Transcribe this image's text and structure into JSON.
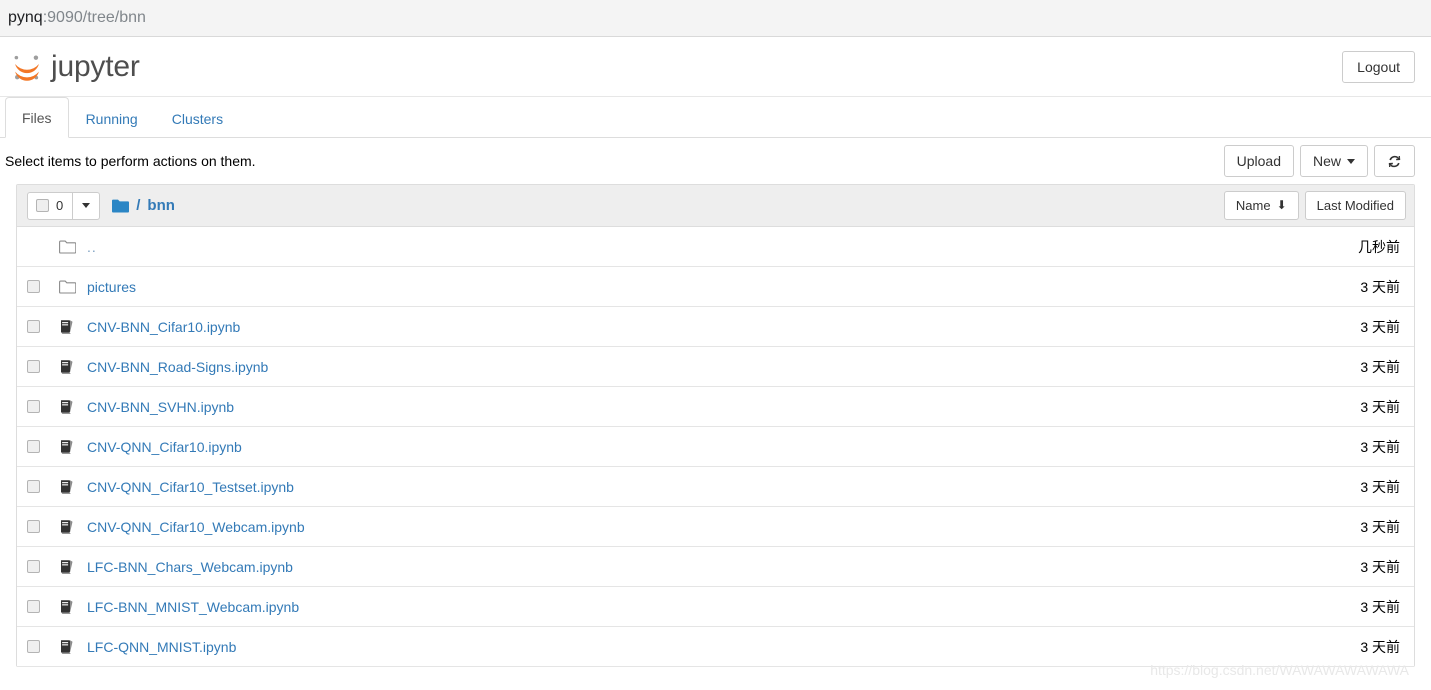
{
  "browser": {
    "url_host": "pynq",
    "url_rest": ":9090/tree/bnn"
  },
  "header": {
    "brand": "jupyter",
    "logout_label": "Logout"
  },
  "tabs": [
    {
      "label": "Files",
      "active": true
    },
    {
      "label": "Running",
      "active": false
    },
    {
      "label": "Clusters",
      "active": false
    }
  ],
  "toolbar": {
    "hint": "Select items to perform actions on them.",
    "upload_label": "Upload",
    "new_label": "New",
    "refresh_title": "refresh-icon"
  },
  "list_header": {
    "selected_count": "0",
    "breadcrumb_sep": "/",
    "breadcrumb_current": "bnn",
    "sort_name_label": "Name",
    "sort_name_arrow": "⬇",
    "sort_modified_label": "Last Modified"
  },
  "files": [
    {
      "name": "..",
      "type": "parent",
      "modified": "几秒前",
      "checkbox": false
    },
    {
      "name": "pictures",
      "type": "folder",
      "modified": "3 天前",
      "checkbox": true
    },
    {
      "name": "CNV-BNN_Cifar10.ipynb",
      "type": "notebook",
      "modified": "3 天前",
      "checkbox": true
    },
    {
      "name": "CNV-BNN_Road-Signs.ipynb",
      "type": "notebook",
      "modified": "3 天前",
      "checkbox": true
    },
    {
      "name": "CNV-BNN_SVHN.ipynb",
      "type": "notebook",
      "modified": "3 天前",
      "checkbox": true
    },
    {
      "name": "CNV-QNN_Cifar10.ipynb",
      "type": "notebook",
      "modified": "3 天前",
      "checkbox": true
    },
    {
      "name": "CNV-QNN_Cifar10_Testset.ipynb",
      "type": "notebook",
      "modified": "3 天前",
      "checkbox": true
    },
    {
      "name": "CNV-QNN_Cifar10_Webcam.ipynb",
      "type": "notebook",
      "modified": "3 天前",
      "checkbox": true
    },
    {
      "name": "LFC-BNN_Chars_Webcam.ipynb",
      "type": "notebook",
      "modified": "3 天前",
      "checkbox": true
    },
    {
      "name": "LFC-BNN_MNIST_Webcam.ipynb",
      "type": "notebook",
      "modified": "3 天前",
      "checkbox": true
    },
    {
      "name": "LFC-QNN_MNIST.ipynb",
      "type": "notebook",
      "modified": "3 天前",
      "checkbox": true
    }
  ],
  "watermark": "https://blog.csdn.net/WAWAWAWAWAWA",
  "colors": {
    "link": "#337ab7",
    "brand_orange": "#f37726",
    "header_bg": "#eeeeee"
  }
}
